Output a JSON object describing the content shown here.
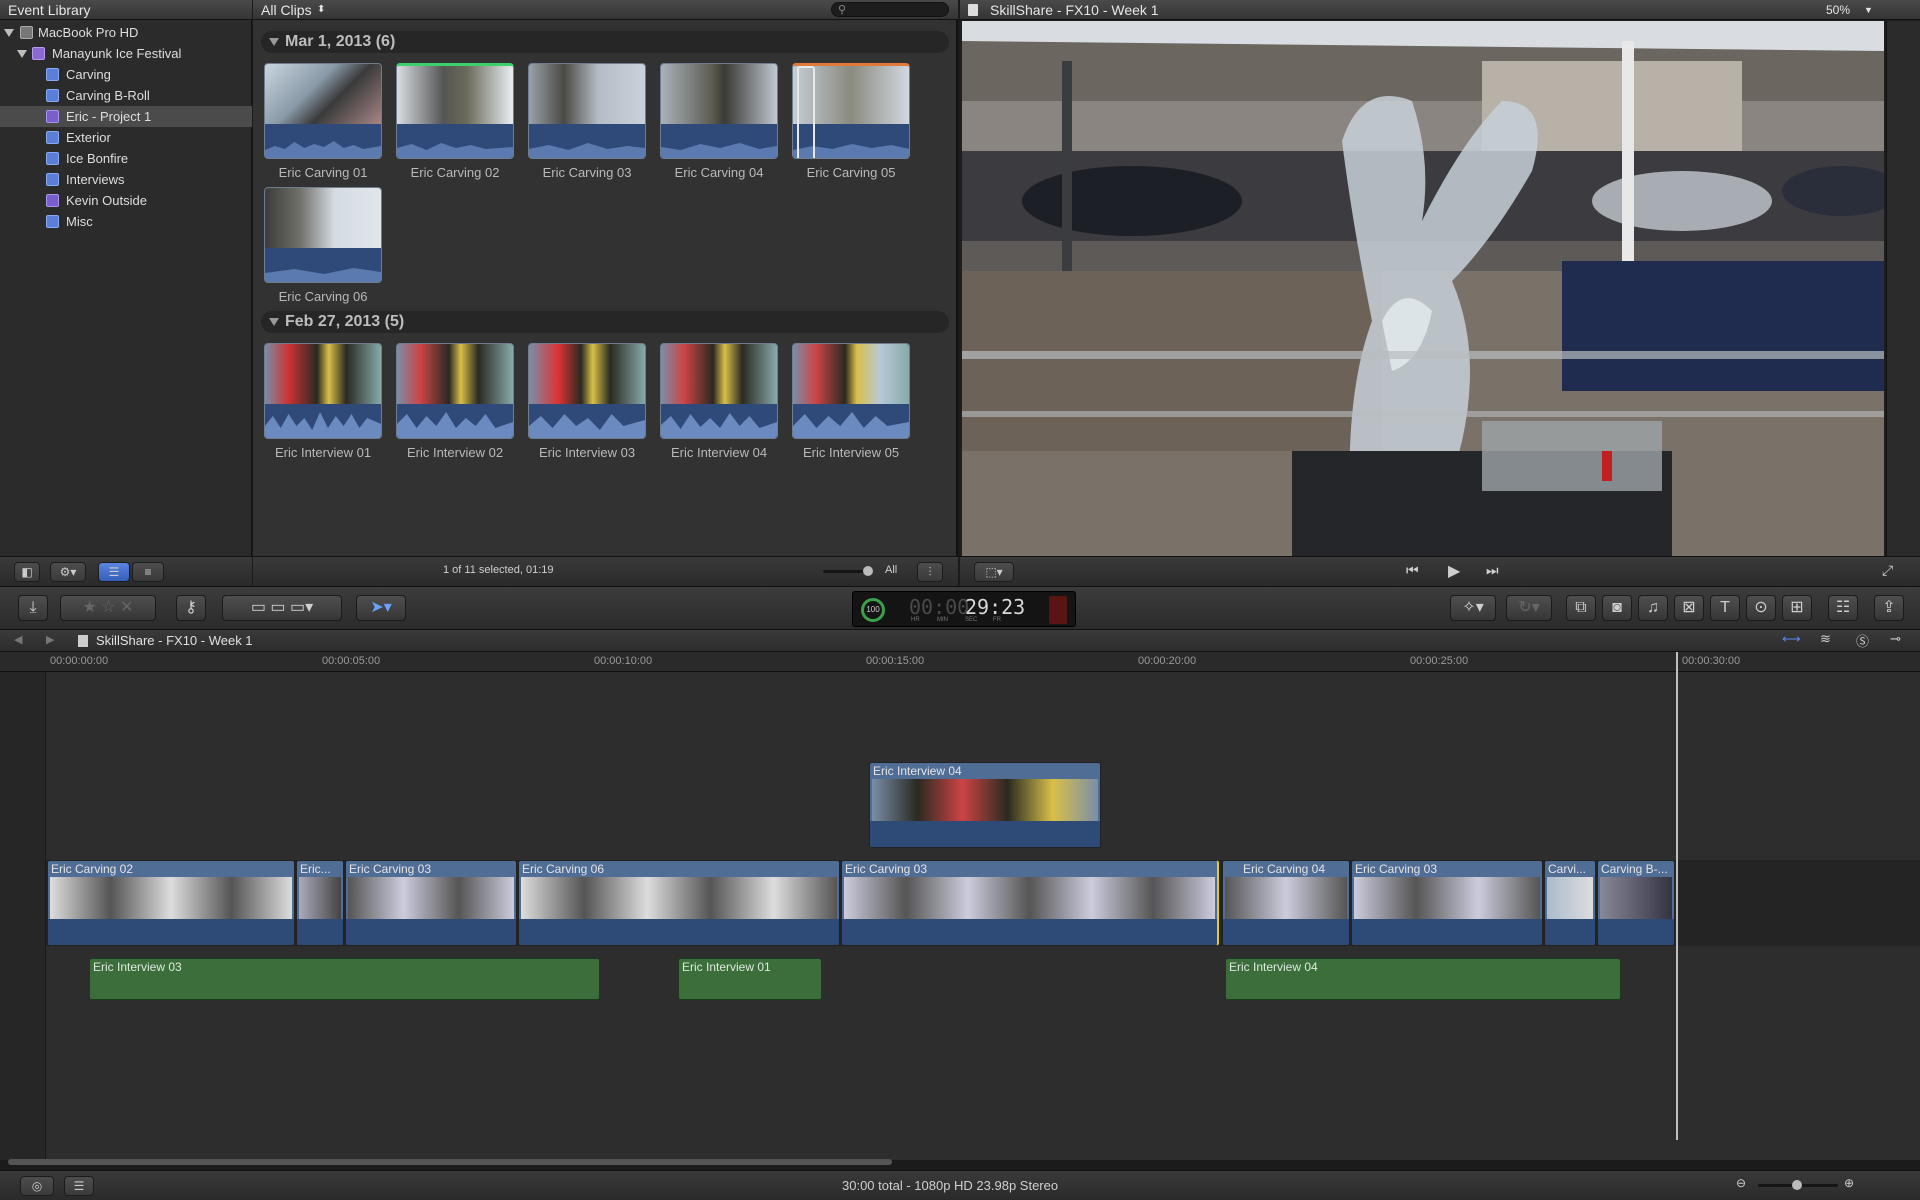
{
  "library": {
    "title": "Event Library",
    "items": [
      {
        "label": "MacBook Pro HD",
        "level": 0,
        "type": "drive"
      },
      {
        "label": "Manayunk Ice Festival",
        "level": 1,
        "type": "festival"
      },
      {
        "label": "Carving",
        "level": 2,
        "type": "event"
      },
      {
        "label": "Carving B-Roll",
        "level": 2,
        "type": "event"
      },
      {
        "label": "Eric - Project 1",
        "level": 2,
        "type": "project",
        "selected": true
      },
      {
        "label": "Exterior",
        "level": 2,
        "type": "event"
      },
      {
        "label": "Ice Bonfire",
        "level": 2,
        "type": "event"
      },
      {
        "label": "Interviews",
        "level": 2,
        "type": "event"
      },
      {
        "label": "Kevin Outside",
        "level": 2,
        "type": "project"
      },
      {
        "label": "Misc",
        "level": 2,
        "type": "event"
      }
    ]
  },
  "browser": {
    "filter": "All Clips",
    "groups": [
      {
        "title": "Mar 1, 2013  (6)",
        "clips": [
          "Eric Carving 01",
          "Eric Carving 02",
          "Eric Carving 03",
          "Eric Carving 04",
          "Eric Carving 05",
          "Eric Carving 06"
        ]
      },
      {
        "title": "Feb 27, 2013  (5)",
        "clips": [
          "Eric Interview 01",
          "Eric Interview 02",
          "Eric Interview 03",
          "Eric Interview 04",
          "Eric Interview 05"
        ]
      }
    ],
    "status": "1 of 11 selected, 01:19",
    "zoom_label": "All"
  },
  "viewer": {
    "title": "SkillShare - FX10 - Week 1",
    "zoom": "50%"
  },
  "toolbar": {
    "timecode": {
      "ring": "100",
      "dim": "00:00",
      "bright": "29:23",
      "units": [
        "HR",
        "MIN",
        "SEC",
        "FR"
      ]
    }
  },
  "timeline": {
    "project": "SkillShare - FX10 - Week 1",
    "ruler": [
      "00:00:00:00",
      "00:00:05:00",
      "00:00:10:00",
      "00:00:15:00",
      "00:00:20:00",
      "00:00:25:00",
      "00:00:30:00"
    ],
    "connected_video": "Eric Interview 04",
    "primary": [
      "Eric Carving 02",
      "Eric...",
      "Eric Carving 03",
      "Eric Carving 06",
      "Eric Carving 03",
      "Eric Carving 04",
      "Eric Carving 03",
      "Carvi...",
      "Carving B-..."
    ],
    "audio": [
      "Eric Interview 03",
      "Eric Interview 01",
      "Eric Interview 04"
    ]
  },
  "status_bar": {
    "text": "30:00 total - 1080p HD 23.98p Stereo"
  },
  "colors": {
    "accent": "#3d6fd8",
    "video_clip": "#4f6d95",
    "audio_clip": "#3b6e3b",
    "playhead": "#bfbfbf"
  }
}
